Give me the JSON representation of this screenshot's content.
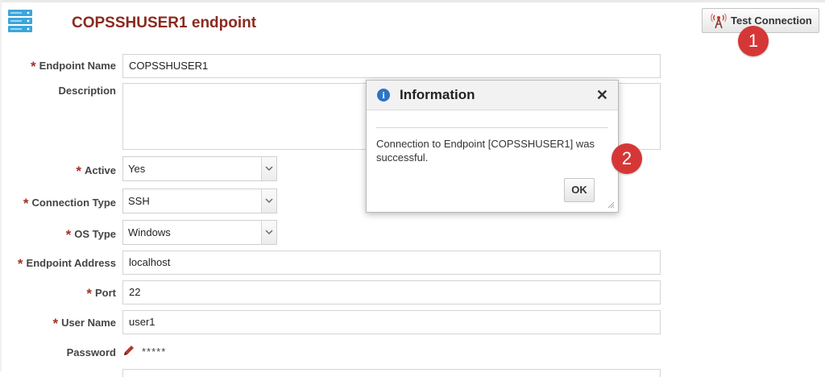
{
  "page": {
    "title": "COPSSHUSER1 endpoint",
    "test_connection_label": "Test Connection"
  },
  "callouts": {
    "one": "1",
    "two": "2"
  },
  "form": {
    "required_marker": "*",
    "endpoint_name": {
      "label": "Endpoint Name",
      "value": "COPSSHUSER1"
    },
    "description": {
      "label": "Description",
      "value": ""
    },
    "active": {
      "label": "Active",
      "value": "Yes"
    },
    "connection_type": {
      "label": "Connection Type",
      "value": "SSH"
    },
    "os_type": {
      "label": "OS Type",
      "value": "Windows"
    },
    "endpoint_address": {
      "label": "Endpoint Address",
      "value": "localhost"
    },
    "port": {
      "label": "Port",
      "value": "22"
    },
    "user_name": {
      "label": "User Name",
      "value": "user1"
    },
    "password": {
      "label": "Password",
      "value": "*****"
    }
  },
  "dialog": {
    "title": "Information",
    "close": "✕",
    "info_glyph": "i",
    "message": "Connection to Endpoint [COPSSHUSER1] was successful.",
    "ok_label": "OK"
  },
  "icons": {
    "endpoint": "server-stack-icon",
    "test_connection": "antenna-icon",
    "password_edit": "pencil-icon",
    "dialog": "info-icon"
  },
  "colors": {
    "title": "#8b2a1f",
    "required": "#a33124",
    "callout": "#d53736",
    "info": "#2d74c4",
    "endpoint_icon": "#3aa6dd"
  }
}
